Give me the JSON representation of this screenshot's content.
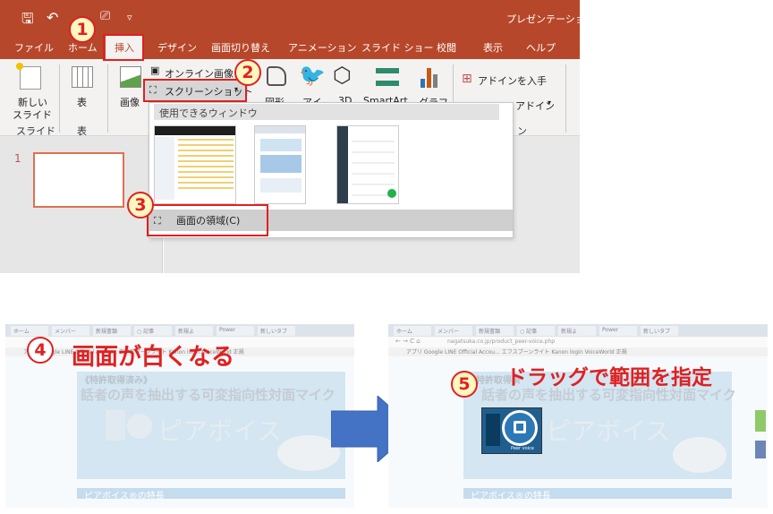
{
  "ppt": {
    "doc_title": "プレゼンテーション1",
    "qa_customize": "▿",
    "menu": {
      "file": "ファイル",
      "home": "ホーム",
      "insert": "挿入",
      "design": "デザイン",
      "transitions": "画面切り替え",
      "animations": "アニメーション",
      "slideshow": "スライド ショー",
      "review": "校閲",
      "view": "表示",
      "help": "ヘルプ"
    },
    "ribbon": {
      "new_slide_1": "新しい",
      "new_slide_2": "スライド",
      "group_slide": "スライド",
      "table": "表",
      "group_table": "表",
      "image": "画像",
      "online_image": "オンライン画像",
      "screenshot": "スクリーンショット",
      "shapes": "図形",
      "icons": "アイ",
      "model3d": "3D",
      "smartart": "SmartArt",
      "chart": "グラフ",
      "addin": "アドインを入手",
      "addin2": "アドイン",
      "group_addin": "ン"
    },
    "dropdown": {
      "header": "使用できるウィンドウ",
      "screen_clipping": "画面の領域(C)"
    },
    "slide_number": "1",
    "callouts": [
      "1",
      "2",
      "3"
    ]
  },
  "bottom": {
    "step4": "4",
    "step4_label": "画面が白くなる",
    "step5": "5",
    "step5_label": "ドラッグで範囲を指定",
    "left_shot": {
      "tabs": [
        "ホーム",
        "メンバー",
        "新規書類",
        "○ 記事",
        "新規よ",
        "Power",
        "新しいタブ"
      ],
      "bookmarks": "アプリ  Google  LINE Official Accou...  エフスプーンライト  Kanon login  VoiceWorld 正規",
      "patent": "《特許取得済み》",
      "headline": "話者の声を抽出する可変指向性対面マイク",
      "brand": "ピアボイス",
      "features": "ピアボイス®の特長"
    },
    "right_shot": {
      "tabs": [
        "ホーム",
        "メンバー",
        "新規書類",
        "○ 記事",
        "新規よ",
        "Power",
        "新しいタブ"
      ],
      "url": "nagatsuka.co.jp/product_peer-voice.php",
      "bookmarks": "アプリ  Google  LINE Official Accou...  エフスプーンライト  Kanon login  VoiceWorld 正規",
      "patent": "《特許取得済",
      "headline": "話者の声を抽出する可変指向性対面マイク",
      "brand": "ピアボイス",
      "logo_text": "Peer voice",
      "features": "ピアボイス®の特長"
    },
    "arrow_color": "#4472c4"
  },
  "colors": {
    "ppt_accent": "#b7472a",
    "callout_red": "#e02020"
  }
}
